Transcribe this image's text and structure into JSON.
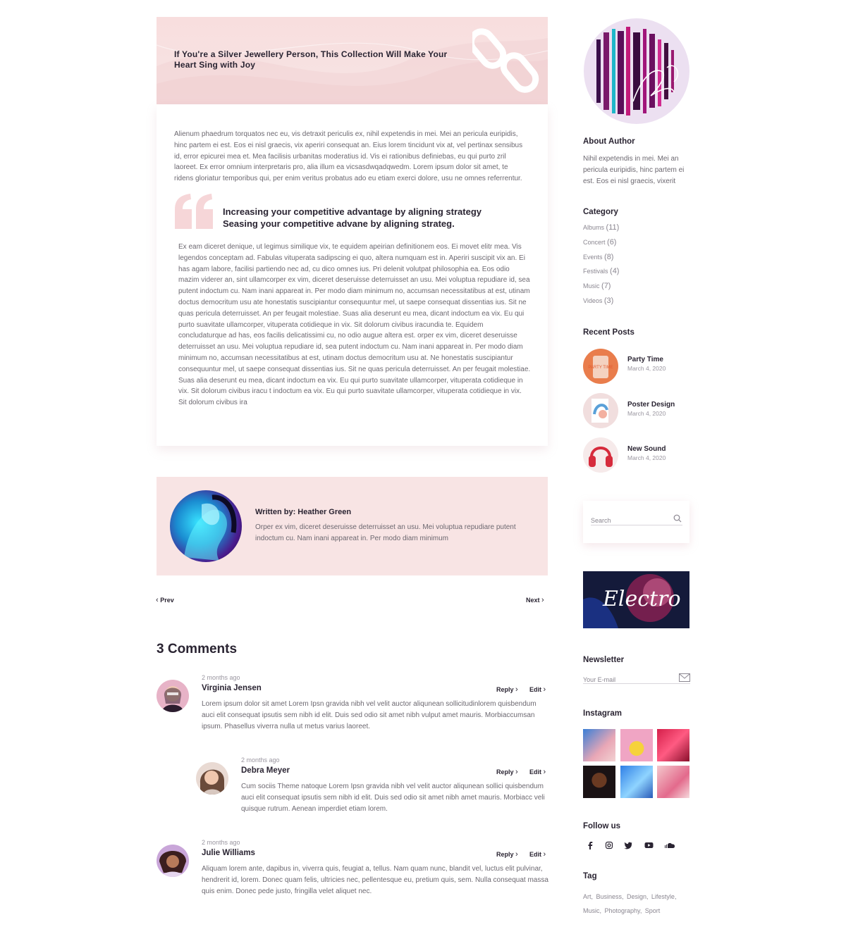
{
  "post": {
    "title": "If You're a Silver Jewellery Person, This Collection Will Make Your Heart Sing with Joy",
    "paragraph1": "Alienum phaedrum torquatos nec eu, vis detraxit periculis ex, nihil expetendis in mei. Mei an pericula euripidis, hinc partem ei est. Eos ei nisl graecis, vix aperiri consequat an. Eius lorem tincidunt vix at, vel pertinax sensibus id, error epicurei mea et. Mea facilisis urbanitas moderatius id. Vis ei rationibus definiebas, eu qui purto zril laoreet. Ex error omnium interpretaris pro, alia illum ea vicsasdwqadqwedm. Lorem ipsum dolor sit amet, te ridens gloriatur temporibus qui, per enim veritus probatus ado eu etiam exerci dolore, usu ne omnes referrentur.",
    "quote_line1": "Increasing your competitive advantage by aligning strategy",
    "quote_line2": "Seasing your competitive advane by aligning strateg.",
    "paragraph2": "Ex eam diceret denique, ut legimus similique vix, te equidem apeirian definitionem eos. Ei movet elitr mea. Vis legendos conceptam ad. Fabulas vituperata sadipscing ei quo, altera numquam est in. Aperiri suscipit vix an. Ei has agam labore, facilisi partiendo nec ad, cu dico omnes ius. Pri delenit volutpat philosophia ea. Eos odio mazim viderer an, sint ullamcorper ex vim, diceret deseruisse deterruisset an usu. Mei voluptua repudiare id, sea putent indoctum cu. Nam inani appareat in. Per modo diam minimum no, accumsan necessitatibus at est, utinam doctus democritum usu ate honestatis suscipiantur consequuntur mel, ut saepe consequat dissentias ius. Sit ne quas pericula deterruisset. An per feugait molestiae. Suas alia deserunt eu mea, dicant indoctum ea vix. Eu qui purto suavitate ullamcorper, vituperata cotidieque in vix. Sit dolorum civibus iracundia te. Equidem concludaturque ad has, eos facilis delicatissimi cu, no odio augue altera est. orper ex vim, diceret deseruisse deterruisset an usu. Mei voluptua repudiare id, sea putent indoctum cu. Nam inani appareat in. Per modo diam minimum no, accumsan necessitatibus at est, utinam doctus democritum usu at. Ne honestatis suscipiantur consequuntur mel, ut saepe consequat dissentias ius. Sit ne quas pericula deterruisset. An per feugait molestiae. Suas alia deserunt eu mea, dicant indoctum ea vix. Eu qui purto suavitate ullamcorper, vituperata cotidieque in vix. Sit dolorum civibus iracu t indoctum ea vix. Eu qui purto suavitate ullamcorper, vituperata cotidieque in vix. Sit dolorum civibus ira"
  },
  "author_box": {
    "name": "Written by: Heather Green",
    "bio": "Orper ex vim, diceret deseruisse deterruisset an usu. Mei voluptua repudiare putent indoctum cu. Nam inani appareat in. Per modo diam minimum"
  },
  "pagination": {
    "prev": "Prev",
    "next": "Next"
  },
  "comments": {
    "title": "3 Comments",
    "reply_label": "Reply",
    "edit_label": "Edit",
    "items": [
      {
        "time": "2 months ago",
        "name": "Virginia Jensen",
        "body": "Lorem ipsum dolor sit amet Lorem Ipsn gravida nibh vel velit auctor aliqunean sollicitudinlorem quisbendum auci elit consequat ipsutis sem nibh id elit. Duis sed odio sit amet nibh vulput amet mauris. Morbiaccumsan ipsum. Phasellus viverra nulla ut metus varius laoreet."
      },
      {
        "time": "2 months ago",
        "name": "Debra Meyer",
        "body": "Cum sociis Theme natoque Lorem Ipsn gravida nibh vel velit auctor aliqunean sollici quisbendum auci elit consequat ipsutis sem nibh id elit. Duis sed odio sit amet nibh amet mauris. Morbiacc veli quisque rutrum. Aenean imperdiet etiam lorem."
      },
      {
        "time": "2 months ago",
        "name": "Julie Williams",
        "body": "Aliquam lorem ante, dapibus in, viverra quis, feugiat a, tellus. Nam quam nunc, blandit vel, luctus elit pulvinar, hendrerit id, lorem. Donec quam felis, ultricies nec, pellentesque eu, pretium quis, sem. Nulla consequat massa quis enim. Donec pede justo, fringilla velet aliquet nec."
      }
    ]
  },
  "sidebar": {
    "about_title": "About Author",
    "about_text": "Nihil expetendis in mei. Mei an pericula euripidis, hinc partem ei est. Eos ei nisl graecis, vixerit",
    "category_title": "Category",
    "categories": [
      {
        "name": "Albums",
        "count": "(11)"
      },
      {
        "name": "Concert",
        "count": "(6)"
      },
      {
        "name": "Events",
        "count": "(8)"
      },
      {
        "name": "Festivals",
        "count": "(4)"
      },
      {
        "name": "Music",
        "count": "(7)"
      },
      {
        "name": "Videos",
        "count": "(3)"
      }
    ],
    "recent_title": "Recent Posts",
    "recent_posts": [
      {
        "title": "Party Time",
        "date": "March 4, 2020",
        "thumb_text": "PARTY TIME"
      },
      {
        "title": "Poster Design",
        "date": "March 4, 2020"
      },
      {
        "title": "New Sound",
        "date": "March 4, 2020"
      }
    ],
    "search_placeholder": "Search",
    "banner_text": "Electro",
    "newsletter_title": "Newsletter",
    "newsletter_placeholder": "Your E-mail",
    "instagram_title": "Instagram",
    "follow_title": "Follow us",
    "social_icons": [
      "facebook-icon",
      "instagram-icon",
      "twitter-icon",
      "youtube-icon",
      "soundcloud-icon"
    ],
    "tag_title": "Tag",
    "tags_line1": [
      "Art,",
      "Business,",
      "Design,",
      "Lifestyle,"
    ],
    "tags_line2": [
      "Music,",
      "Photography,",
      "Sport"
    ]
  },
  "colors": {
    "accent_pink": "#f8e4e4",
    "heading": "#2a2432",
    "body_text": "#6c6870"
  }
}
